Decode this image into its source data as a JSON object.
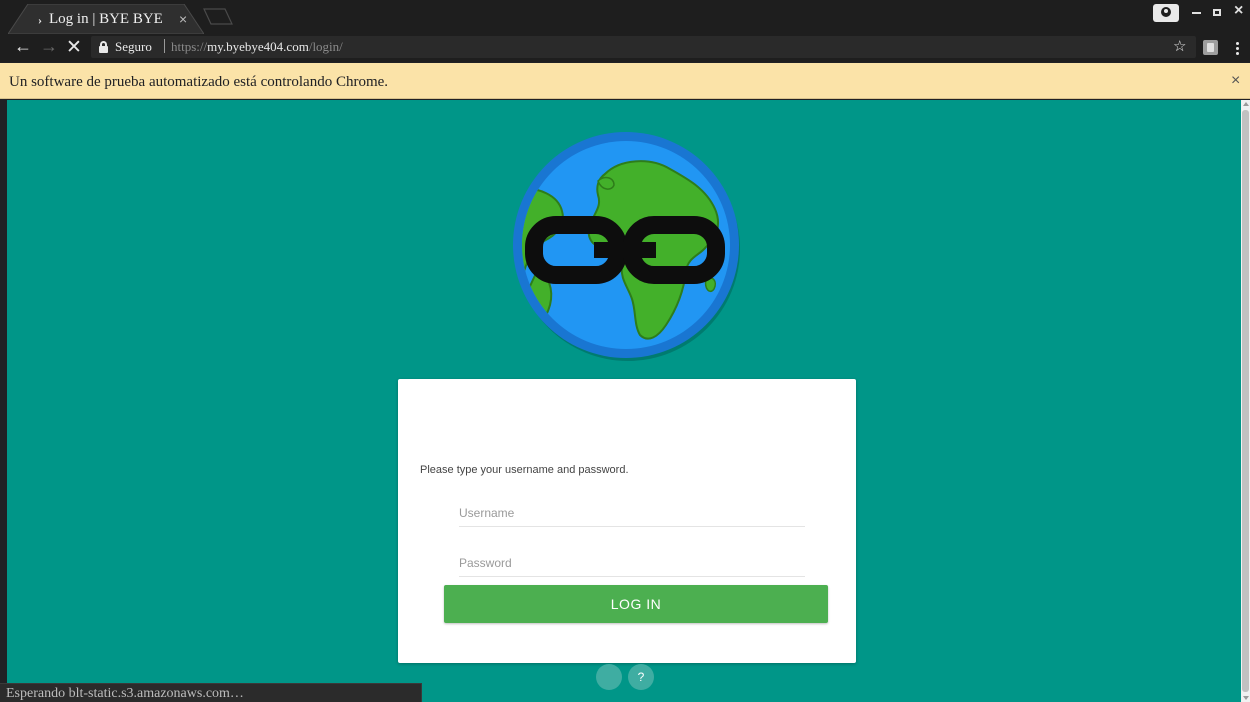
{
  "browser": {
    "tab": {
      "favicon": "›",
      "title": "Log in | BYE BYE",
      "close_glyph": "×"
    },
    "address_bar": {
      "secure_label": "Seguro",
      "url_scheme": "https://",
      "url_host": "my.byebye404.com",
      "url_path": "/login/"
    },
    "infobar": {
      "message": "Un software de prueba automatizado está controlando Chrome.",
      "close_glyph": "×"
    },
    "status": "Esperando blt-static.s3.amazonaws.com…"
  },
  "login": {
    "instructions": "Please type your username and password.",
    "username_placeholder": "Username",
    "password_placeholder": "Password",
    "submit_label": "LOG IN"
  },
  "footer_buttons": {
    "help_label": "?"
  },
  "colors": {
    "page_background": "#009688",
    "login_button": "#4caf50",
    "infobar": "#fbe3a8",
    "chrome_frame": "#1e1e1e"
  },
  "icons": [
    "back-arrow-icon",
    "forward-arrow-icon",
    "stop-icon",
    "lock-icon",
    "star-icon",
    "extension-icon",
    "menu-icon",
    "profile-icon",
    "globe-chain-logo"
  ]
}
